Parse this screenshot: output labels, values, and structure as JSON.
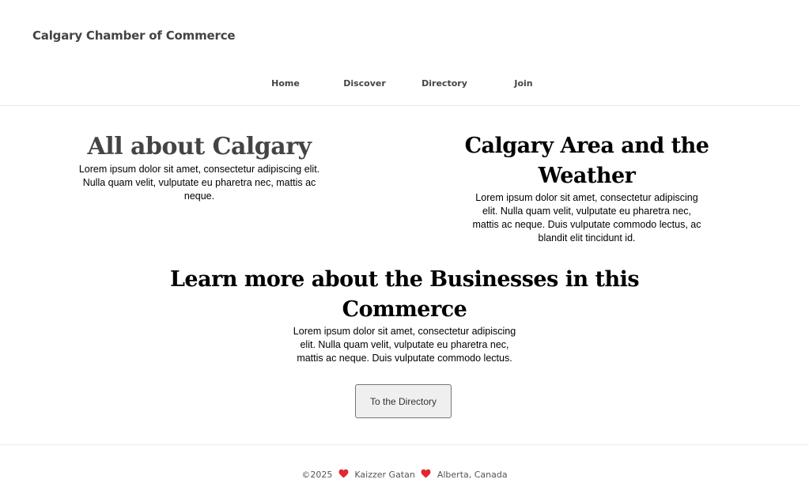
{
  "header": {
    "site_title": "Calgary Chamber of Commerce"
  },
  "nav": {
    "items": [
      {
        "label": "Home"
      },
      {
        "label": "Discover"
      },
      {
        "label": "Directory"
      },
      {
        "label": "Join"
      }
    ]
  },
  "sections": {
    "about": {
      "heading": "All about Calgary",
      "text": "Lorem ipsum dolor sit amet, consectetur adipiscing elit. Nulla quam velit, vulputate eu pharetra nec, mattis ac neque."
    },
    "weather": {
      "heading": "Calgary Area and the Weather",
      "text": "Lorem ipsum dolor sit amet, consectetur adipiscing elit. Nulla quam velit, vulputate eu pharetra nec, mattis ac neque. Duis vulputate commodo lectus, ac blandit elit tincidunt id."
    },
    "businesses": {
      "heading": "Learn more about the Businesses in this Commerce",
      "text": "Lorem ipsum dolor sit amet, consectetur adipiscing elit. Nulla quam velit, vulputate eu pharetra nec, mattis ac neque. Duis vulputate commodo lectus.",
      "button_label": "To the Directory"
    }
  },
  "footer": {
    "copyright": "©2025",
    "author": "Kaizzer Gatan",
    "location": "Alberta, Canada",
    "heart_icon": "heart-icon",
    "heart_color": "#e0282e"
  },
  "colors": {
    "title_gray": "#444444",
    "divider": "#e6e6e6",
    "button_bg": "#efefef"
  }
}
